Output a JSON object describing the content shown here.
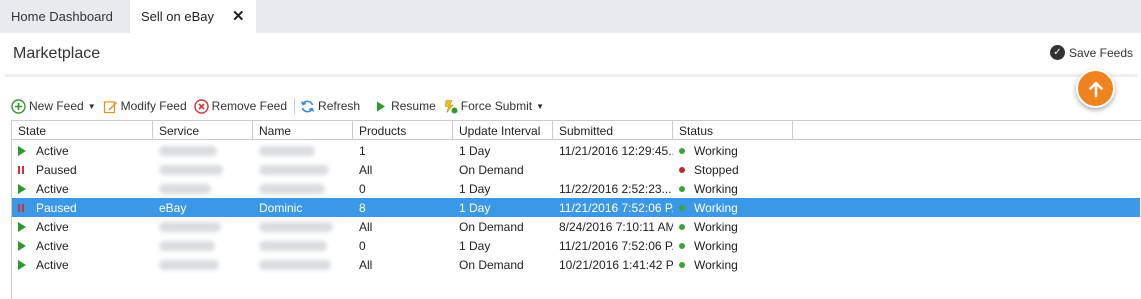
{
  "tabs": [
    {
      "label": "Home Dashboard"
    },
    {
      "label": "Sell on eBay",
      "close": "✕"
    }
  ],
  "header": {
    "title": "Marketplace",
    "save_feeds": "Save Feeds"
  },
  "toolbar": {
    "new_feed": "New Feed",
    "modify_feed": "Modify Feed",
    "remove_feed": "Remove Feed",
    "refresh": "Refresh",
    "resume": "Resume",
    "force_submit": "Force Submit"
  },
  "grid": {
    "columns": [
      "State",
      "Service",
      "Name",
      "Products",
      "Update Interval",
      "Submitted",
      "Status"
    ],
    "rows": [
      {
        "state": "Active",
        "state_kind": "active",
        "service": "",
        "name": "",
        "products": "1",
        "interval": "1 Day",
        "submitted": "11/21/2016  12:29:45...",
        "status": "Working",
        "status_color": "green"
      },
      {
        "state": "Paused",
        "state_kind": "paused",
        "service": "",
        "name": "",
        "products": "All",
        "interval": "On Demand",
        "submitted": "",
        "status": "Stopped",
        "status_color": "red"
      },
      {
        "state": "Active",
        "state_kind": "active",
        "service": "",
        "name": "",
        "products": "0",
        "interval": "1 Day",
        "submitted": "11/22/2016  2:52:23...",
        "status": "Working",
        "status_color": "green"
      },
      {
        "state": "Paused",
        "state_kind": "paused",
        "service": "eBay",
        "name": "Dominic",
        "products": "8",
        "interval": "1 Day",
        "submitted": "11/21/2016 7:52:06 P...",
        "status": "Working",
        "status_color": "green",
        "selected": true
      },
      {
        "state": "Active",
        "state_kind": "active",
        "service": "",
        "name": "",
        "products": "All",
        "interval": "On Demand",
        "submitted": "8/24/2016 7:10:11 AM",
        "status": "Working",
        "status_color": "green"
      },
      {
        "state": "Active",
        "state_kind": "active",
        "service": "",
        "name": "",
        "products": "0",
        "interval": "1 Day",
        "submitted": "11/21/2016 7:52:06 P...",
        "status": "Working",
        "status_color": "green"
      },
      {
        "state": "Active",
        "state_kind": "active",
        "service": "",
        "name": "",
        "products": "All",
        "interval": "On Demand",
        "submitted": "10/21/2016  1:41:42  P...",
        "status": "Working",
        "status_color": "green"
      }
    ]
  },
  "colors": {
    "accent": "#f0831f",
    "selection": "#3a98e6",
    "active": "#2e9a2e",
    "paused": "#d0343a"
  }
}
